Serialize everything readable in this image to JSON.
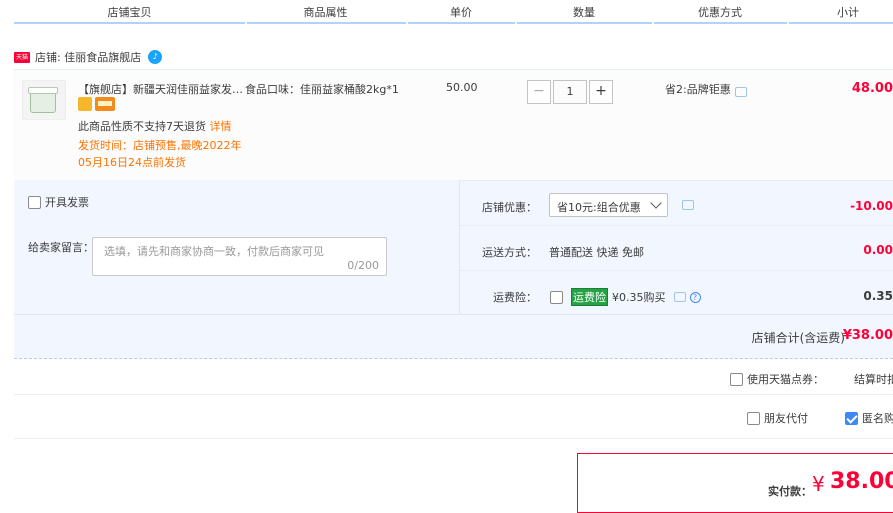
{
  "header": {
    "columns": [
      "店铺宝贝",
      "商品属性",
      "单价",
      "数量",
      "优惠方式",
      "小计"
    ]
  },
  "shop": {
    "badge": "天猫",
    "label": "店铺: 佳丽食品旗舰店"
  },
  "item": {
    "title": "【旗舰店】新疆天润佳丽益家发…",
    "attribute": "食品口味：佳丽益家桶酸2kg*1",
    "price": "50.00",
    "quantity": "1",
    "return_note": "此商品性质不支持7天退货",
    "return_link": "详情",
    "ship_time": "发货时间：店铺预售,最晚2022年05月16日24点前发货",
    "promotion": "省2:品牌钜惠",
    "subtotal": "48.00"
  },
  "options": {
    "invoice_label": "开具发票",
    "message_label": "给卖家留言：",
    "message_placeholder": "选填，请先和商家协商一致，付款后商家可见",
    "message_count": "0/200",
    "shop_discount_label": "店铺优惠：",
    "shop_discount_select": "省10元:组合优惠",
    "shop_discount_value": "-10.00",
    "shipping_label": "运送方式：",
    "shipping_value": "普通配送 快递 免邮",
    "shipping_cost": "0.00",
    "insurance_label": "运费险：",
    "insurance_tag": "运费险",
    "insurance_price": "¥0.35购买",
    "insurance_cost": "0.35"
  },
  "total": {
    "label": "店铺合计(含运费)",
    "value": "¥38.00"
  },
  "footer": {
    "coupon_label": "使用天猫点券：",
    "settle_text": "结算时扣减",
    "friend_pay": "朋友代付",
    "anonymous": "匿名购买",
    "pay_label": "实付款：",
    "pay_yen": "¥",
    "pay_value": "38.00"
  },
  "colors": {
    "accent_red": "#ff0036",
    "accent_orange": "#ff7300",
    "header_line": "#b2d1ff",
    "option_bg": "#f2f7ff"
  }
}
